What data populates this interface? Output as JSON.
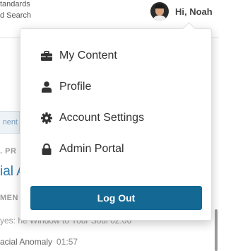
{
  "header": {
    "nav_line_1": "tandards",
    "nav_line_2": "d Search",
    "greeting": "Hi, Noah"
  },
  "background": {
    "sidebar_tab_text": "nent",
    "section_prefix": ". PR",
    "title_fragment": "ial A",
    "section_label": "MEN",
    "item_1": "yes: he Window to Your Soul 02:06",
    "item_2": "acial Anomaly",
    "item_2_time": "01:57"
  },
  "menu": {
    "items": [
      {
        "label": "My Content",
        "icon": "briefcase-icon"
      },
      {
        "label": "Profile",
        "icon": "user-icon"
      },
      {
        "label": "Account Settings",
        "icon": "gear-icon"
      },
      {
        "label": "Admin Portal",
        "icon": "lock-icon"
      }
    ],
    "logout_label": "Log Out"
  },
  "colors": {
    "accent": "#146894",
    "menu_text": "#333333",
    "link": "#2a7ab0"
  }
}
